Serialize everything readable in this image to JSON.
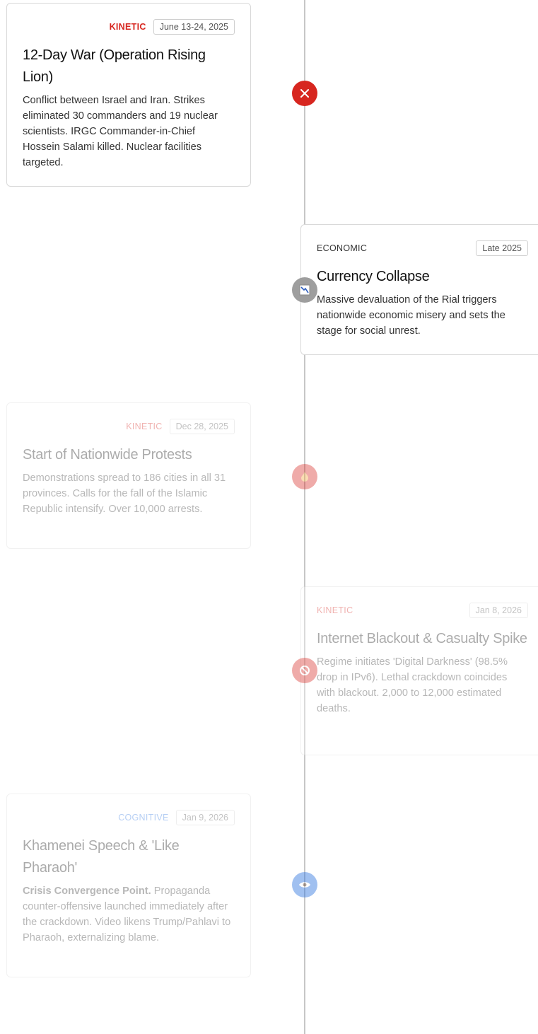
{
  "colors": {
    "kinetic": "#d7261f",
    "economic": "#333333",
    "cognitive": "#2f76e0",
    "line": "#c7c7c7"
  },
  "events": [
    {
      "tag": "KINETIC",
      "date": "June 13-24, 2025",
      "title": "12-Day War (Operation Rising Lion)",
      "description": "Conflict between Israel and Iran. Strikes eliminated 30 commanders and 19 nuclear scientists. IRGC Commander-in-Chief Hossein Salami killed. Nuclear facilities targeted.",
      "icon": "crossed-swords-icon"
    },
    {
      "tag": "ECONOMIC",
      "date": "Late 2025",
      "title": "Currency Collapse",
      "description": "Massive devaluation of the Rial triggers nationwide economic misery and sets the stage for social unrest.",
      "icon": "chart-down-icon"
    },
    {
      "tag": "KINETIC",
      "date": "Dec 28, 2025",
      "title": "Start of Nationwide Protests",
      "description": "Demonstrations spread to 186 cities in all 31 provinces. Calls for the fall of the Islamic Republic intensify. Over 10,000 arrests.",
      "icon": "fire-icon"
    },
    {
      "tag": "KINETIC",
      "date": "Jan 8, 2026",
      "title": "Internet Blackout & Casualty Spike",
      "description": "Regime initiates 'Digital Darkness' (98.5% drop in IPv6). Lethal crackdown coincides with blackout. 2,000 to 12,000 estimated deaths.",
      "icon": "no-signal-icon"
    },
    {
      "tag": "COGNITIVE",
      "date": "Jan 9, 2026",
      "title": "Khamenei Speech & 'Like Pharaoh'",
      "description_lead": "Crisis Convergence Point.",
      "description": "Propaganda counter-offensive launched immediately after the crackdown. Video likens Trump/Pahlavi to Pharaoh, externalizing blame.",
      "icon": "eye-icon"
    }
  ]
}
